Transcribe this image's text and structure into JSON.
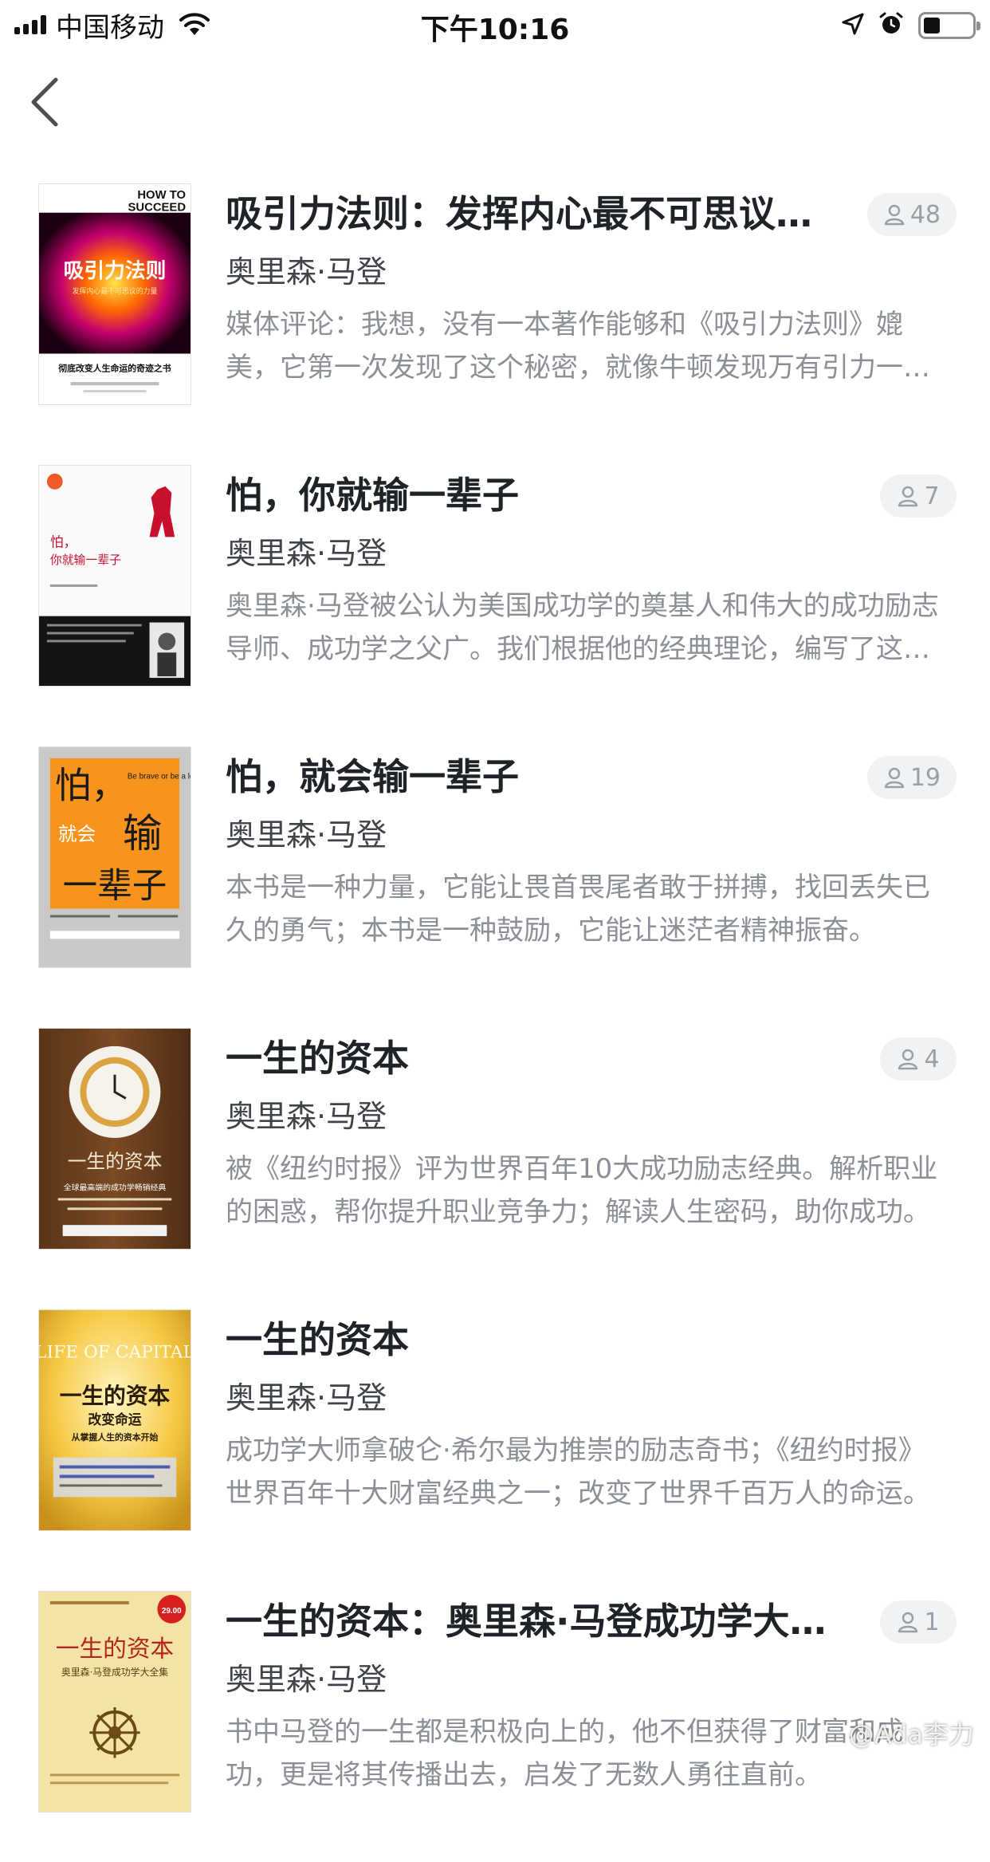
{
  "status_bar": {
    "carrier": "中国移动",
    "time": "下午10:16",
    "icons": [
      "signal-icon",
      "wifi-icon",
      "location-icon",
      "alarm-icon",
      "battery-icon"
    ]
  },
  "nav": {
    "back_icon": "chevron-left-icon"
  },
  "books": [
    {
      "title": "吸引力法则：发挥内心最不可思议的力量",
      "author": "奥里森·马登",
      "description": "媒体评论：我想，没有一本著作能够和《吸引力法则》媲美，它第一次发现了这个秘密，就像牛顿发现万有引力一样。",
      "readers": "48",
      "cover": {
        "top_text": "HOW TO",
        "top_text2": "SUCCEED",
        "main": "吸引力法则",
        "sub": "发挥内心最不可思议的力量",
        "bottom": "彻底改变人生命运的奇迹之书"
      }
    },
    {
      "title": "怕，你就输一辈子",
      "author": "奥里森·马登",
      "description": "奥里森·马登被公认为美国成功学的奠基人和伟大的成功励志导师、成功学之父广。我们根据他的经典理论，编写了这本书。",
      "readers": "7",
      "cover": {
        "main": "怕，",
        "main2": "你就输一辈子"
      }
    },
    {
      "title": "怕，就会输一辈子",
      "author": "奥里森·马登",
      "description": "本书是一种力量，它能让畏首畏尾者敢于拼搏，找回丢失已久的勇气；本书是一种鼓励，它能让迷茫者精神振奋。",
      "readers": "19",
      "cover": {
        "main": "怕，",
        "main2": "就会",
        "main3": "输",
        "main4": "一辈子",
        "en": "Be brave or be a loser"
      }
    },
    {
      "title": "一生的资本",
      "author": "奥里森·马登",
      "description": "被《纽约时报》评为世界百年10大成功励志经典。解析职业的困惑，帮你提升职业竞争力；解读人生密码，助你成功。",
      "readers": "4",
      "cover": {
        "main": "一生的资本",
        "sub": "全球最高端的成功学畅销经典"
      }
    },
    {
      "title": "一生的资本",
      "author": "奥里森·马登",
      "description": "成功学大师拿破仑·希尔最为推崇的励志奇书；《纽约时报》世界百年十大财富经典之一；改变了世界千百万人的命运。",
      "readers": "",
      "cover": {
        "en": "LIFE OF CAPITAL",
        "main": "一生的资本",
        "sub": "改变命运",
        "sub2": "从掌握人生的资本开始"
      }
    },
    {
      "title": "一生的资本：奥里森·马登成功学大全集",
      "author": "奥里森·马登",
      "description": "书中马登的一生都是积极向上的，他不但获得了财富和成功，更是将其传播出去，启发了无数人勇往直前。",
      "readers": "1",
      "cover": {
        "main": "一生的资本",
        "sub": "奥里森·马登成功学大全集",
        "price": "29.00"
      }
    }
  ],
  "watermark": "@Ada李力",
  "colors": {
    "badge_bg": "#f1f2f4",
    "badge_text": "#9aa0a6",
    "title": "#1f2328",
    "desc": "#8c9096"
  }
}
